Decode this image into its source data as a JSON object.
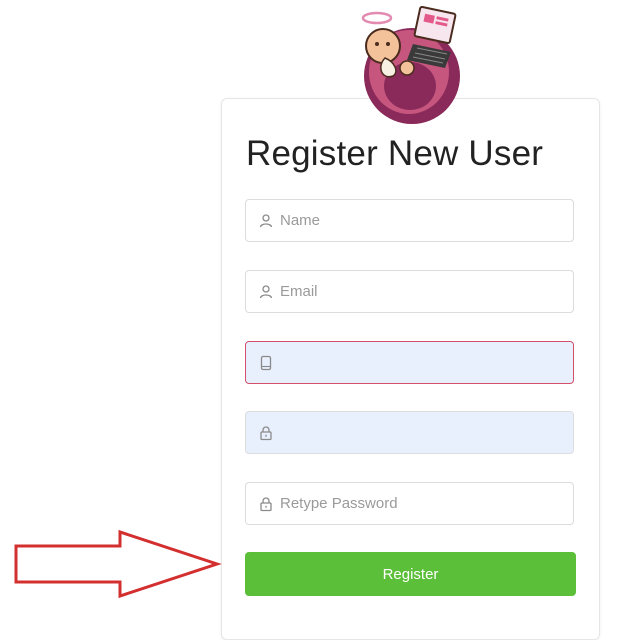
{
  "form": {
    "title": "Register New User",
    "name_placeholder": "Name",
    "email_placeholder": "Email",
    "phone_value": "",
    "password_value": "",
    "retype_placeholder": "Retype Password",
    "submit_label": "Register"
  },
  "colors": {
    "button": "#5cbf3a",
    "autofill_bg": "#e9f0fd",
    "error_border": "#d2506a",
    "arrow": "#d32f2f"
  },
  "icons": {
    "name": "user-icon",
    "email": "user-icon",
    "phone": "mobile-icon",
    "password": "lock-icon",
    "retype": "lock-icon"
  }
}
